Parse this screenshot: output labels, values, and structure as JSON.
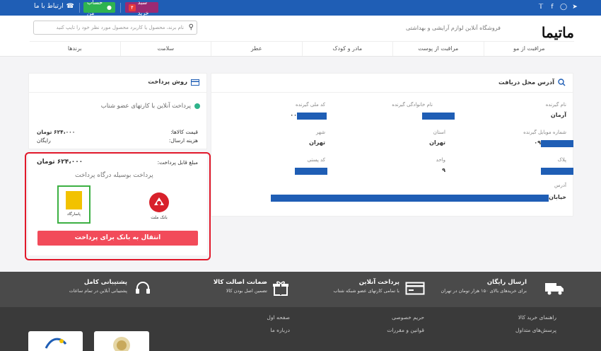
{
  "topbar": {
    "social": [
      "twitter-icon",
      "facebook-icon",
      "instagram-icon",
      "telegram-icon"
    ],
    "cart_label": "سبد خرید",
    "cart_count": "۴",
    "account_label": "حساب من",
    "contact_label": "ارتباط با ما"
  },
  "header": {
    "logo": "ماتیما",
    "tagline": "فروشگاه آنلاین لوازم آرایشی و بهداشتی",
    "search_placeholder": "نام برند، محصول یا کاربرد محصول مورد نظر خود را تایپ کنید",
    "nav": [
      "مراقبت از مو",
      "مراقبت از پوست",
      "مادر و کودک",
      "عطر",
      "سلامت",
      "برندها"
    ]
  },
  "address": {
    "title": "آدرس محل دریافت",
    "fields": {
      "name_label": "نام گیرنده",
      "name_value": "آرمان",
      "family_label": "نام خانوادگی گیرنده",
      "national_label": "کد ملی گیرنده",
      "national_value": "۰۰",
      "mobile_label": "شماره موبایل گیرنده",
      "mobile_value": "۰۹",
      "province_label": "استان",
      "province_value": "تهران",
      "city_label": "شهر",
      "city_value": "تهران",
      "plaque_label": "پلاک",
      "unit_label": "واحد",
      "unit_value": "۹",
      "postal_label": "کد پستی",
      "address_label": "آدرس",
      "address_value": "خیابان"
    }
  },
  "payment": {
    "title": "روش پرداخت",
    "option": "پرداخت آنلاین با کارتهای عضو شتاب",
    "goods_price_label": "قیمت کالاها:",
    "goods_price_value": "۶۲۴،۰۰۰ تومان",
    "shipping_label": "هزینه ارسال:",
    "shipping_value": "رایگان",
    "payable_label": "مبلغ قابل پرداخت:",
    "payable_value": "۶۲۴،۰۰۰ تومان",
    "gateway_title": "پرداخت بوسیله درگاه پرداخت",
    "bank1_name": "بانک ملت",
    "bank2_name": "پاسارگاد",
    "bank_button": "انتقال به بانک برای پرداخت"
  },
  "features": [
    {
      "title": "ارسال رایگان",
      "subtitle": "برای خریدهای بالای ۱۵۰ هزار تومان در تهران",
      "icon": "truck-icon"
    },
    {
      "title": "پرداخت آنلاین",
      "subtitle": "با تمامی کارتهای عضو شبکه شتاب",
      "icon": "card-icon"
    },
    {
      "title": "ضمانت اصالت کالا",
      "subtitle": "تضمین اصل بودن کالا",
      "icon": "gift-icon"
    },
    {
      "title": "پشتیبانی کامل",
      "subtitle": "پشتیبانی آنلاین در تمام ساعات",
      "icon": "headset-icon"
    }
  ],
  "footer": {
    "col1": [
      "راهنمای خرید کالا",
      "پرسش‌های متداول"
    ],
    "col2": [
      "حریم خصوصی",
      "قوانین و مقررات"
    ],
    "col3": [
      "صفحه اول",
      "درباره ما"
    ]
  },
  "colors": {
    "primary": "#1f5eb5",
    "accent": "#f24b5a",
    "highlight": "#e1182a",
    "success": "#2fb350"
  }
}
